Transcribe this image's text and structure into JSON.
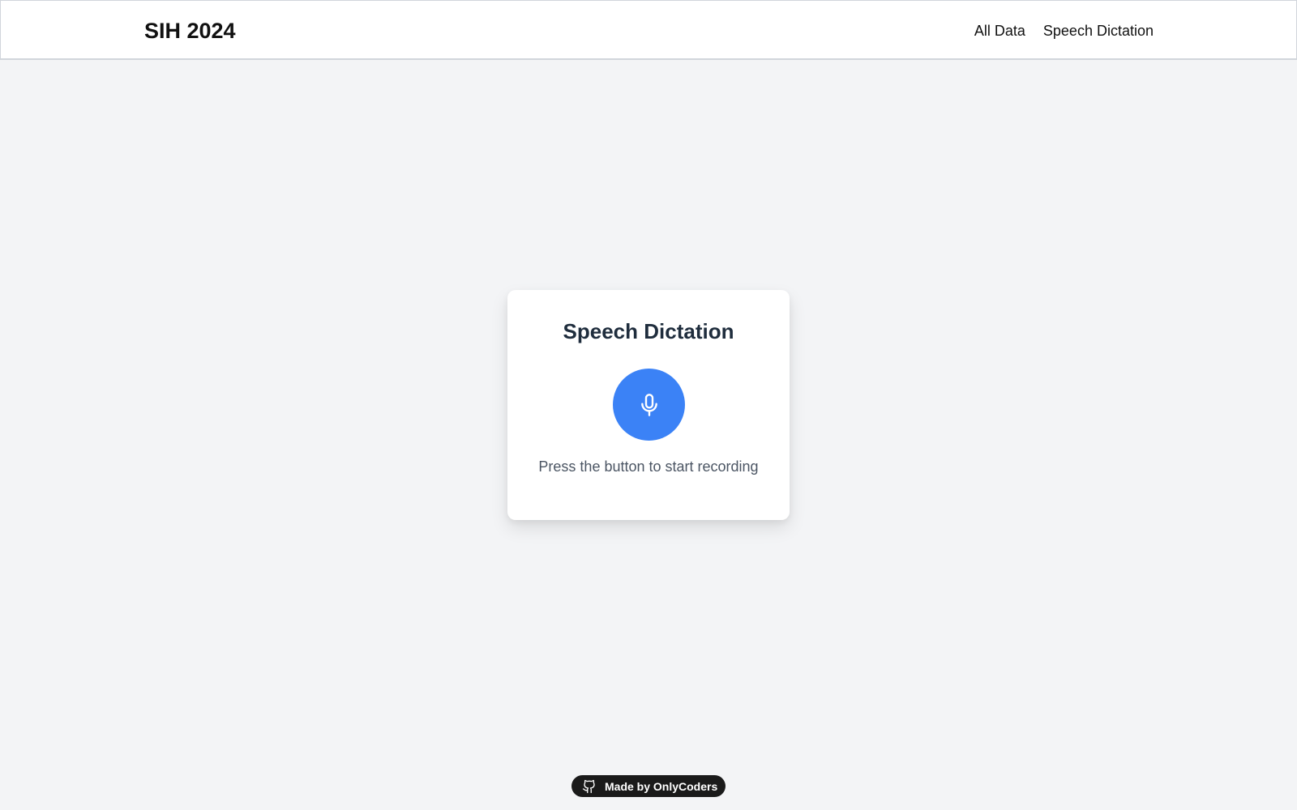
{
  "navbar": {
    "brand": "SIH 2024",
    "links": [
      {
        "label": "All Data"
      },
      {
        "label": "Speech Dictation"
      }
    ]
  },
  "card": {
    "title": "Speech Dictation",
    "mic_icon": "microphone-icon",
    "status": "Press the button to start recording",
    "accent_color": "#3b82f6"
  },
  "footer_badge": {
    "icon": "github-icon",
    "label": "Made by OnlyCoders"
  }
}
